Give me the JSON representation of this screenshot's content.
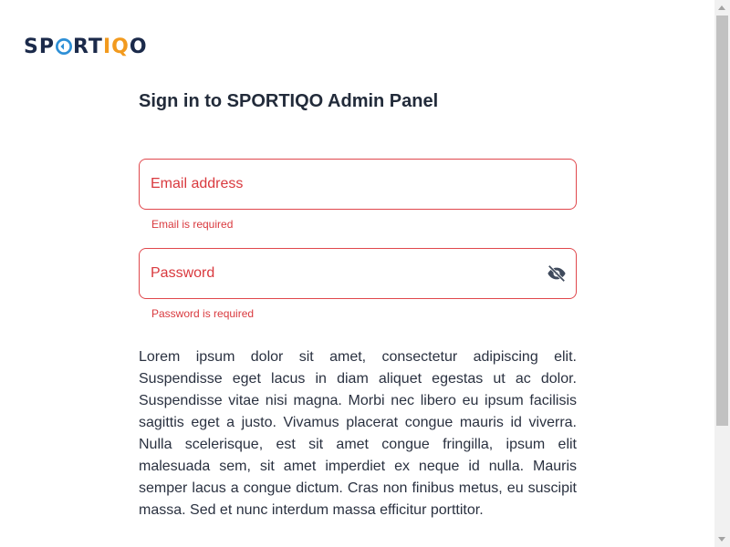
{
  "brand": {
    "prefix": "SP",
    "middle": "RT",
    "accent": "IQ",
    "suffix": "O",
    "colors": {
      "dark": "#1b2a4a",
      "accent": "#f29a1e",
      "mark": "#2d8fd6"
    }
  },
  "login": {
    "title": "Sign in to SPORTIQO Admin Panel",
    "email": {
      "placeholder": "Email address",
      "value": "",
      "error": "Email is required"
    },
    "password": {
      "placeholder": "Password",
      "value": "",
      "error": "Password is required",
      "toggle_icon": "eye-off-icon"
    },
    "description": "Lorem ipsum dolor sit amet, consectetur adipiscing elit. Suspendisse eget lacus in diam aliquet egestas ut ac dolor. Suspendisse vitae nisi magna. Morbi nec libero eu ipsum facilisis sagittis eget a justo. Vivamus placerat congue mauris id viverra. Nulla scelerisque, est sit amet congue fringilla, ipsum elit malesuada sem, sit amet imperdiet ex neque id nulla. Mauris semper lacus a congue dictum. Cras non finibus metus, eu suscipit massa. Sed et nunc interdum massa efficitur porttitor."
  },
  "colors": {
    "error": "#d9393e",
    "border_error": "#e0474c",
    "text": "#222b3a"
  }
}
